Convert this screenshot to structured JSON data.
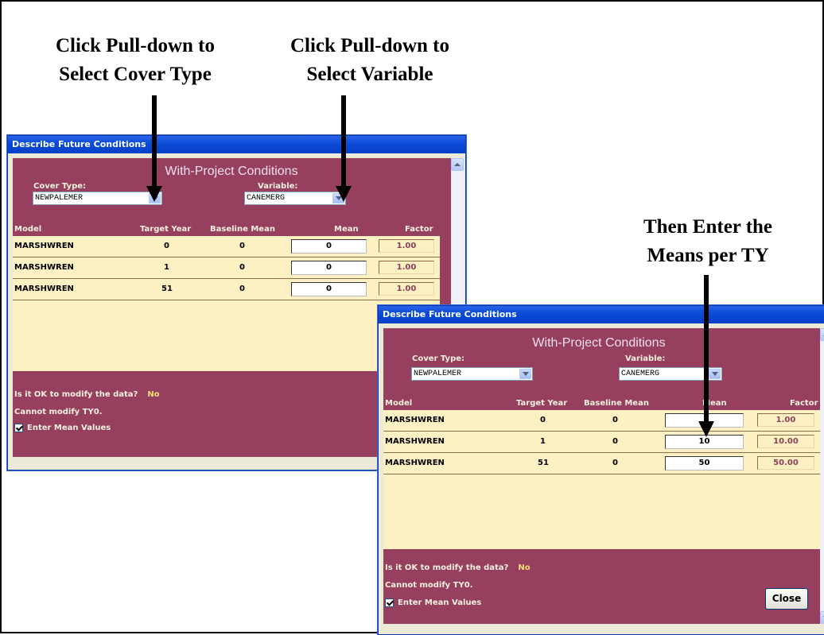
{
  "captions": {
    "cover_type": [
      "Click Pull-down to",
      "Select Cover Type"
    ],
    "variable": [
      "Click Pull-down to",
      "Select Variable"
    ],
    "means": [
      "Then Enter the",
      "Means per TY"
    ]
  },
  "window_back": {
    "title": "Describe Future Conditions",
    "heading": "With-Project Conditions",
    "cover_type_label": "Cover Type:",
    "cover_type_value": "NEWPALEMER",
    "variable_label": "Variable:",
    "variable_value": "CANEMERG",
    "columns": [
      "Model",
      "Target Year",
      "Baseline Mean",
      "Mean",
      "Factor"
    ],
    "rows": [
      {
        "model": "MARSHWREN",
        "target_year": "0",
        "baseline_mean": "0",
        "mean": "0",
        "factor": "1.00"
      },
      {
        "model": "MARSHWREN",
        "target_year": "1",
        "baseline_mean": "0",
        "mean": "0",
        "factor": "1.00"
      },
      {
        "model": "MARSHWREN",
        "target_year": "51",
        "baseline_mean": "0",
        "mean": "0",
        "factor": "1.00"
      }
    ],
    "modify_question": "Is it OK to modify the data?",
    "modify_answer": "No",
    "cannot_modify": "Cannot modify TY0.",
    "enter_mean_values": "Enter Mean Values"
  },
  "window_front": {
    "title": "Describe Future Conditions",
    "heading": "With-Project Conditions",
    "cover_type_label": "Cover Type:",
    "cover_type_value": "NEWPALEMER",
    "variable_label": "Variable:",
    "variable_value": "CANEMERG",
    "columns": [
      "Model",
      "Target Year",
      "Baseline Mean",
      "Mean",
      "Factor"
    ],
    "rows": [
      {
        "model": "MARSHWREN",
        "target_year": "0",
        "baseline_mean": "0",
        "mean": "",
        "factor": "1.00"
      },
      {
        "model": "MARSHWREN",
        "target_year": "1",
        "baseline_mean": "0",
        "mean": "10",
        "factor": "10.00"
      },
      {
        "model": "MARSHWREN",
        "target_year": "51",
        "baseline_mean": "0",
        "mean": "50",
        "factor": "50.00"
      }
    ],
    "modify_question": "Is it OK to modify the data?",
    "modify_answer": "No",
    "cannot_modify": "Cannot modify TY0.",
    "enter_mean_values": "Enter Mean Values",
    "close_label": "Close"
  }
}
